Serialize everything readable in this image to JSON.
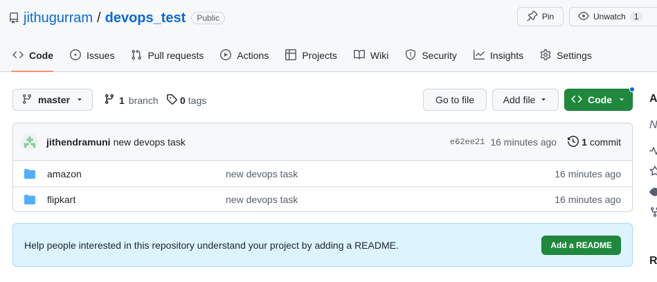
{
  "repo": {
    "owner": "jithugurram",
    "name": "devops_test",
    "visibility": "Public"
  },
  "actions": {
    "pin": "Pin",
    "unwatch": "Unwatch",
    "watch_count": "1"
  },
  "tabs": [
    {
      "label": "Code",
      "icon": "code-icon",
      "active": true
    },
    {
      "label": "Issues",
      "icon": "issue-icon"
    },
    {
      "label": "Pull requests",
      "icon": "pull-request-icon"
    },
    {
      "label": "Actions",
      "icon": "play-icon"
    },
    {
      "label": "Projects",
      "icon": "table-icon"
    },
    {
      "label": "Wiki",
      "icon": "book-icon"
    },
    {
      "label": "Security",
      "icon": "shield-icon"
    },
    {
      "label": "Insights",
      "icon": "graph-icon"
    },
    {
      "label": "Settings",
      "icon": "gear-icon"
    }
  ],
  "toolbar": {
    "branch": "master",
    "branch_count": "1",
    "branch_word": "branch",
    "tag_count": "0",
    "tag_word": "tags",
    "go_to_file": "Go to file",
    "add_file": "Add file",
    "code": "Code"
  },
  "latest_commit": {
    "author": "jithendramuni",
    "message": "new devops task",
    "sha": "e62ee21",
    "time": "16 minutes ago",
    "commit_count": "1",
    "commit_word": "commit"
  },
  "files": [
    {
      "name": "amazon",
      "message": "new devops task",
      "time": "16 minutes ago",
      "type": "folder"
    },
    {
      "name": "flipkart",
      "message": "new devops task",
      "time": "16 minutes ago",
      "type": "folder"
    }
  ],
  "readme": {
    "text": "Help people interested in this repository understand your project by adding a README.",
    "button": "Add a README"
  },
  "sidebar": {
    "heading_fragment": "A",
    "desc_fragment": "N",
    "heading2_fragment": "R"
  },
  "colors": {
    "link": "#0969da",
    "primary_button": "#1f883d",
    "active_tab_underline": "#fd8c73",
    "banner_bg": "#ddf4ff",
    "folder": "#54aeff"
  }
}
